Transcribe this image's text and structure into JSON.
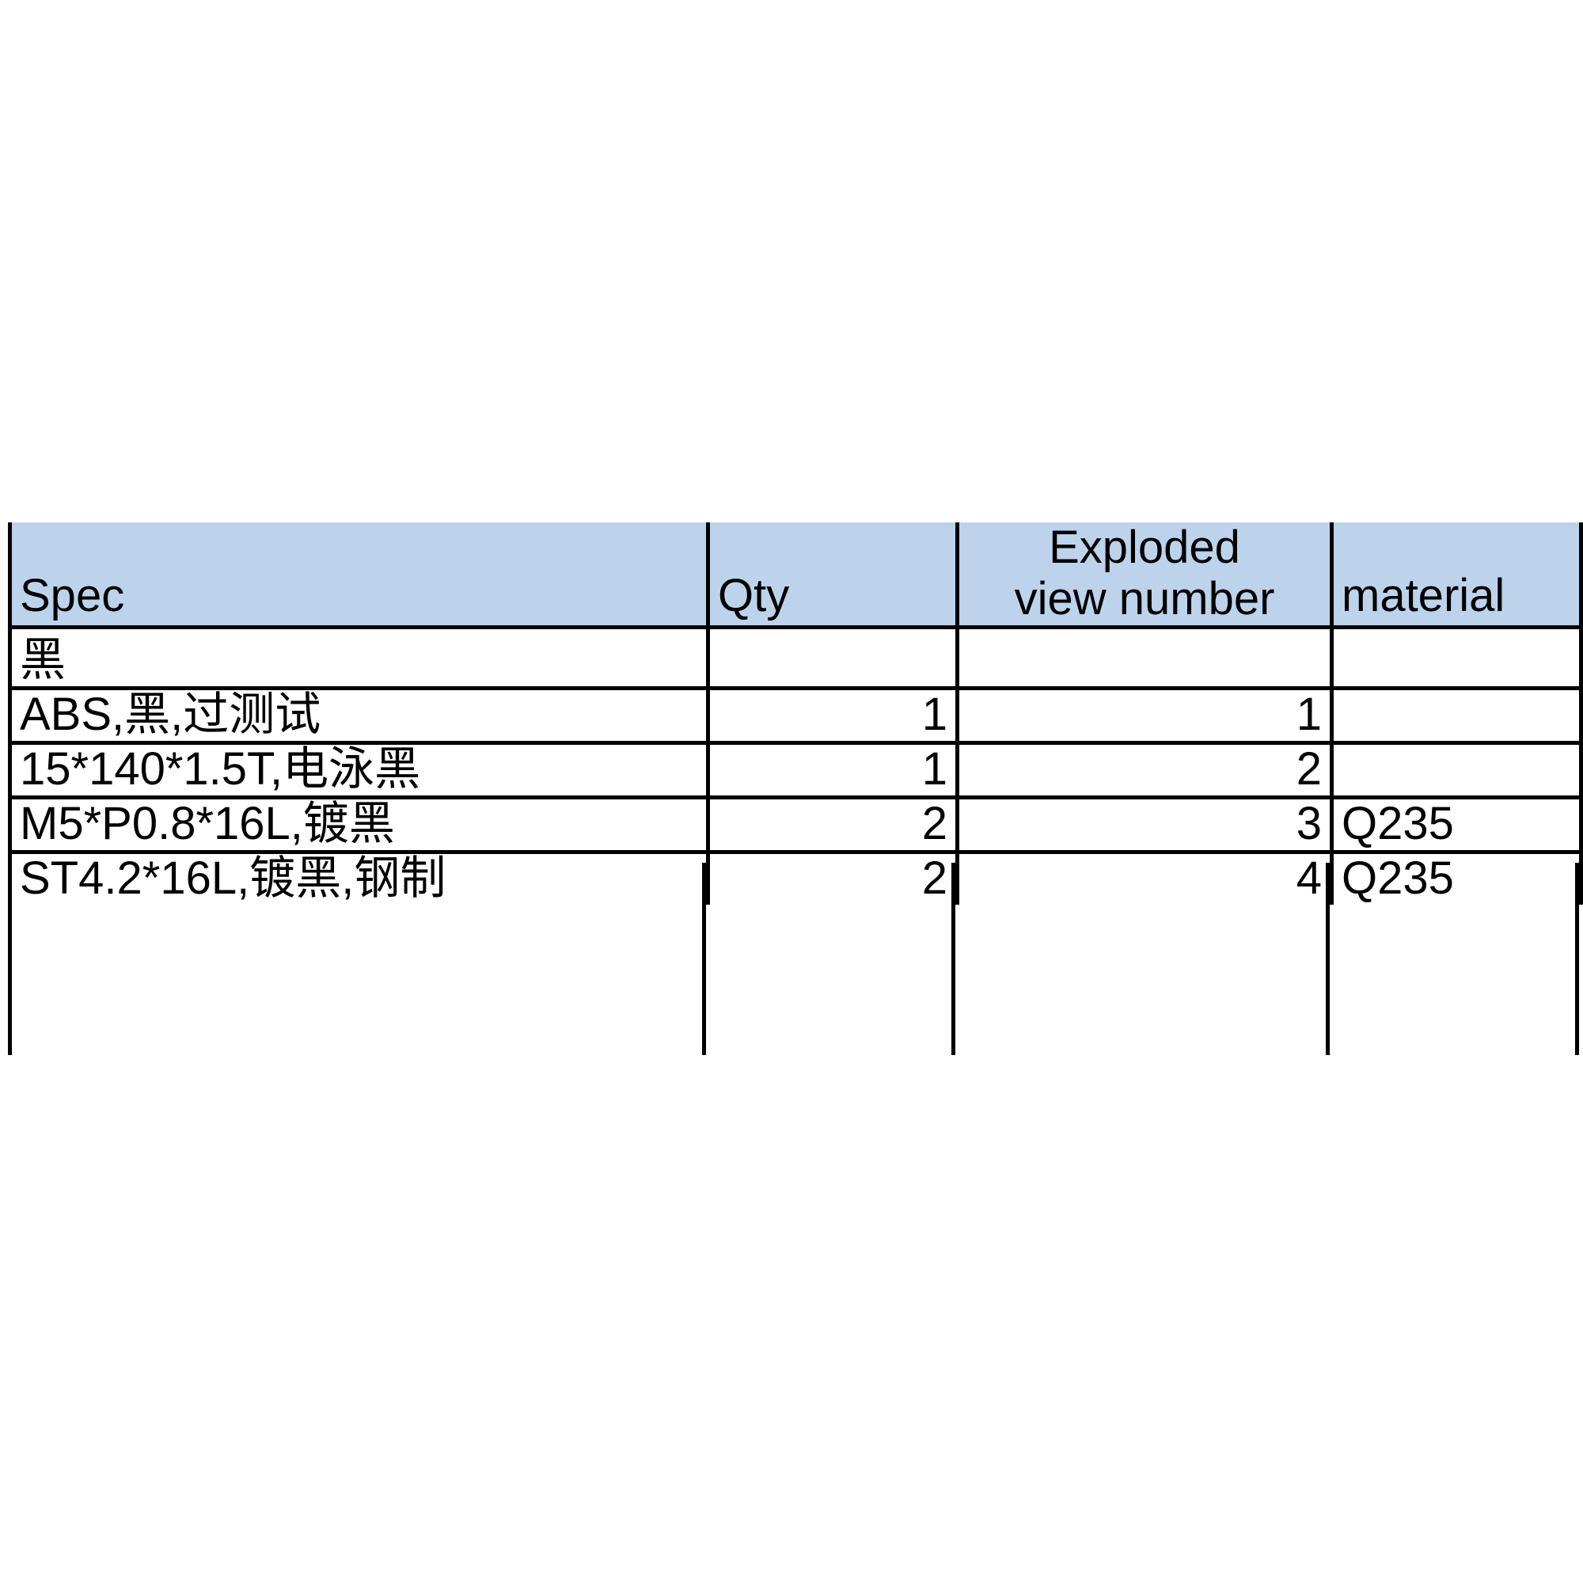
{
  "table": {
    "name": "bill-of-materials",
    "header_background": "#BDD3EC",
    "border_color": "#000000",
    "columns": [
      {
        "key": "spec",
        "label": "Spec",
        "align": "left"
      },
      {
        "key": "qty",
        "label": "Qty",
        "align": "right"
      },
      {
        "key": "exploded",
        "label": "Exploded\nview number",
        "align": "right"
      },
      {
        "key": "material",
        "label": "material",
        "align": "left"
      }
    ],
    "headers": {
      "spec": "Spec",
      "qty": "Qty",
      "exploded_line1": "Exploded",
      "exploded_line2": "view number",
      "material": "material"
    },
    "rows": [
      {
        "spec": "黑",
        "qty": "",
        "exploded": "",
        "material": ""
      },
      {
        "spec": "ABS,黑,过测试",
        "qty": "1",
        "exploded": "1",
        "material": ""
      },
      {
        "spec": "15*140*1.5T,电泳黑",
        "qty": "1",
        "exploded": "2",
        "material": ""
      },
      {
        "spec": "M5*P0.8*16L,镀黑",
        "qty": "2",
        "exploded": "3",
        "material": "Q235"
      },
      {
        "spec": "ST4.2*16L,镀黑,钢制",
        "qty": "2",
        "exploded": "4",
        "material": "Q235"
      }
    ]
  }
}
